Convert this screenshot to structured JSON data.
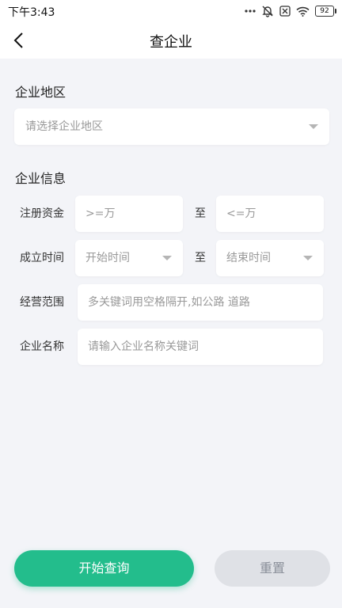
{
  "status_bar": {
    "time": "下午3:43",
    "battery": "92"
  },
  "nav": {
    "title": "查企业"
  },
  "region": {
    "title": "企业地区",
    "select_placeholder": "请选择企业地区"
  },
  "info": {
    "title": "企业信息",
    "capital": {
      "label": "注册资金",
      "min_placeholder": ">=万",
      "to": "至",
      "max_placeholder": "<=万"
    },
    "founded": {
      "label": "成立时间",
      "start_placeholder": "开始时间",
      "to": "至",
      "end_placeholder": "结束时间"
    },
    "scope": {
      "label": "经营范围",
      "placeholder": "多关键词用空格隔开,如公路 道路"
    },
    "name": {
      "label": "企业名称",
      "placeholder": "请输入企业名称关键词"
    }
  },
  "actions": {
    "search_label": "开始查询",
    "reset_label": "重置"
  },
  "colors": {
    "accent": "#23bd8c",
    "background": "#f3f4f8",
    "reset_bg": "#dfe1e6"
  }
}
